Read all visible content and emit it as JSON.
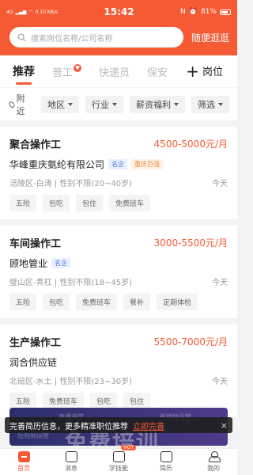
{
  "statusbar": {
    "signal_text": "4G",
    "speed": "0.10 KB/s",
    "time": "15:42",
    "battery": "81%"
  },
  "search": {
    "placeholder": "搜索岗位名称/公司名称",
    "browse_label": "随便逛逛"
  },
  "tabs": [
    {
      "label": "推荐"
    },
    {
      "label": "普工"
    },
    {
      "label": "快递员"
    },
    {
      "label": "保安"
    }
  ],
  "add_post_label": "岗位",
  "filters": {
    "nearby": "附近",
    "chips": [
      "地区",
      "行业",
      "薪资福利",
      "筛选"
    ]
  },
  "jobs": [
    {
      "title": "聚合操作工",
      "salary": "4500-5000元/月",
      "company": "华峰重庆氨纶有限公司",
      "tag1": "名企",
      "tag2": "重庆百强",
      "location": "涪陵区-白涛",
      "requirement": "性别不限(20~40岁)",
      "date": "今天",
      "benefits": [
        "五险",
        "包吃",
        "包住",
        "免费班车"
      ]
    },
    {
      "title": "车间操作工",
      "salary": "3000-5500元/月",
      "company": "顾地管业",
      "tag1": "名企",
      "location": "璧山区-青杠",
      "requirement": "性别不限(18~45岁)",
      "date": "今天",
      "benefits": [
        "五险",
        "包吃",
        "免费班车",
        "餐补",
        "定期体检"
      ]
    },
    {
      "title": "生产操作工",
      "salary": "5500-7000元/月",
      "company": "润合供应链",
      "location": "北碚区-水土",
      "requirement": "性别不限(23~30岁)",
      "date": "今天",
      "benefits": [
        "五险",
        "免费班车",
        "包吃",
        "包住"
      ]
    }
  ],
  "banner": {
    "small1": "直播讲堂",
    "small2": "新媒体运营",
    "small3": "短视频运营",
    "big": "免费培训"
  },
  "notice": {
    "text": "完善简历信息，更多精准职位推荐",
    "link": "立即完善",
    "close": "×"
  },
  "bottomnav": [
    {
      "label": "首页"
    },
    {
      "label": "消息"
    },
    {
      "label": "学技能",
      "badge": "HOT"
    },
    {
      "label": "简历"
    },
    {
      "label": "我的"
    }
  ],
  "colors": {
    "accent": "#f45a33",
    "blue_tag": "#4a6edc",
    "orange_tag": "#f08a3c"
  }
}
